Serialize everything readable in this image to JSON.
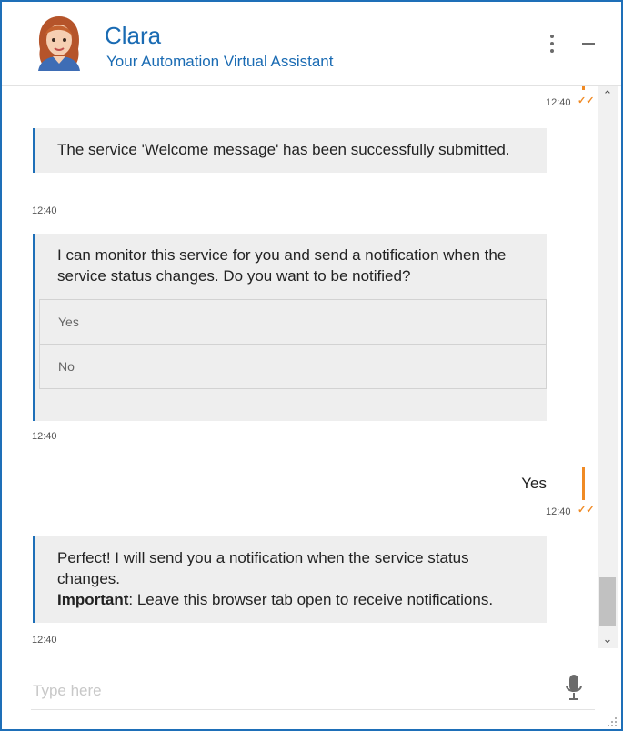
{
  "header": {
    "title": "Clara",
    "subtitle": "Your Automation Virtual Assistant"
  },
  "messages": {
    "top_time": "12:40",
    "m1": {
      "text": "The service 'Welcome message' has been successfully submitted.",
      "time": "12:40"
    },
    "m2": {
      "text": "I can monitor this service for you and send a notification when the service status changes. Do you want to be notified?",
      "options": [
        "Yes",
        "No"
      ],
      "time": "12:40"
    },
    "m3": {
      "text": "Yes",
      "time": "12:40"
    },
    "m4": {
      "text": "Perfect! I will send you a notification when the service status changes.",
      "important_label": "Important",
      "important_text": ": Leave this browser tab open to receive notifications.",
      "time": "12:40"
    }
  },
  "input": {
    "placeholder": "Type here"
  },
  "colors": {
    "brand": "#1e6fb8",
    "accent": "#f08a24",
    "bubble": "#eeeeee"
  },
  "icons": [
    "more-vertical-icon",
    "minimize-icon",
    "scroll-up-icon",
    "scroll-down-icon",
    "check-icon",
    "microphone-icon",
    "resize-grip-icon"
  ]
}
